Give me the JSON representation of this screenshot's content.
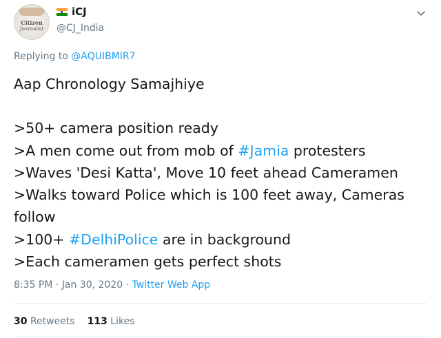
{
  "author": {
    "avatar_line1": "Citizen",
    "avatar_line2": "Journalist",
    "display_name": "iCJ",
    "handle": "@CJ_India",
    "flag_colors": [
      "#ff9933",
      "#ffffff",
      "#138808"
    ]
  },
  "reply": {
    "prefix": "Replying to ",
    "mention": "@AQUIBMIR7"
  },
  "tweet": {
    "lines": [
      [
        {
          "t": "Aap Chronology Samajhiye"
        }
      ],
      [],
      [
        {
          "t": ">50+ camera position ready"
        }
      ],
      [
        {
          "t": ">A men come out from mob of "
        },
        {
          "t": "#Jamia",
          "tag": true
        },
        {
          "t": " protesters"
        }
      ],
      [
        {
          "t": ">Waves 'Desi Katta', Move 10 feet ahead Cameramen"
        }
      ],
      [
        {
          "t": ">Walks toward Police which is 100 feet away, Cameras"
        }
      ],
      [
        {
          "t": "follow"
        }
      ],
      [
        {
          "t": ">100+ "
        },
        {
          "t": "#DelhiPolice",
          "tag": true
        },
        {
          "t": " are in background"
        }
      ],
      [
        {
          "t": ">Each cameramen gets perfect shots"
        }
      ]
    ]
  },
  "meta": {
    "timestamp": "8:35 PM · Jan 30, 2020 · ",
    "source": "Twitter Web App"
  },
  "stats": {
    "retweets_count": "30",
    "retweets_label": "Retweets",
    "likes_count": "113",
    "likes_label": "Likes"
  },
  "colors": {
    "link": "#1da1f2",
    "muted": "#657786",
    "text": "#14171a"
  },
  "icons": {
    "menu": "chevron-down-icon",
    "flag": "india-flag-icon"
  }
}
